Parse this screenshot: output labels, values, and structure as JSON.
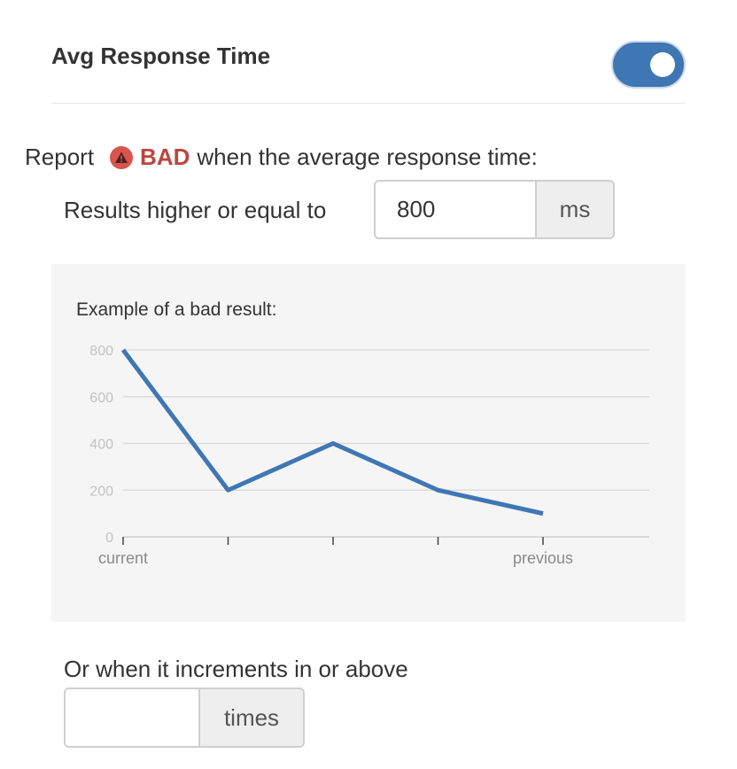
{
  "header": {
    "title": "Avg Response Time",
    "toggle_on": true
  },
  "report": {
    "prefix": "Report",
    "severity": "BAD",
    "severity_icon": "warning-icon",
    "suffix": "when the average response time:"
  },
  "threshold": {
    "label": "Results higher or equal to",
    "value": "800",
    "unit": "ms"
  },
  "example": {
    "title": "Example of a bad result:"
  },
  "increments": {
    "label": "Or when it increments in or above",
    "value": "",
    "unit": "times"
  },
  "colors": {
    "accent": "#3f76b4",
    "bad": "#b9453f",
    "badge": "#d9534f"
  },
  "chart_data": {
    "type": "line",
    "x": [
      "current",
      "",
      "",
      "",
      "previous"
    ],
    "values": [
      800,
      200,
      400,
      200,
      100
    ],
    "yticks": [
      0,
      200,
      400,
      600,
      800
    ],
    "ylim": [
      0,
      800
    ],
    "grid": true
  }
}
